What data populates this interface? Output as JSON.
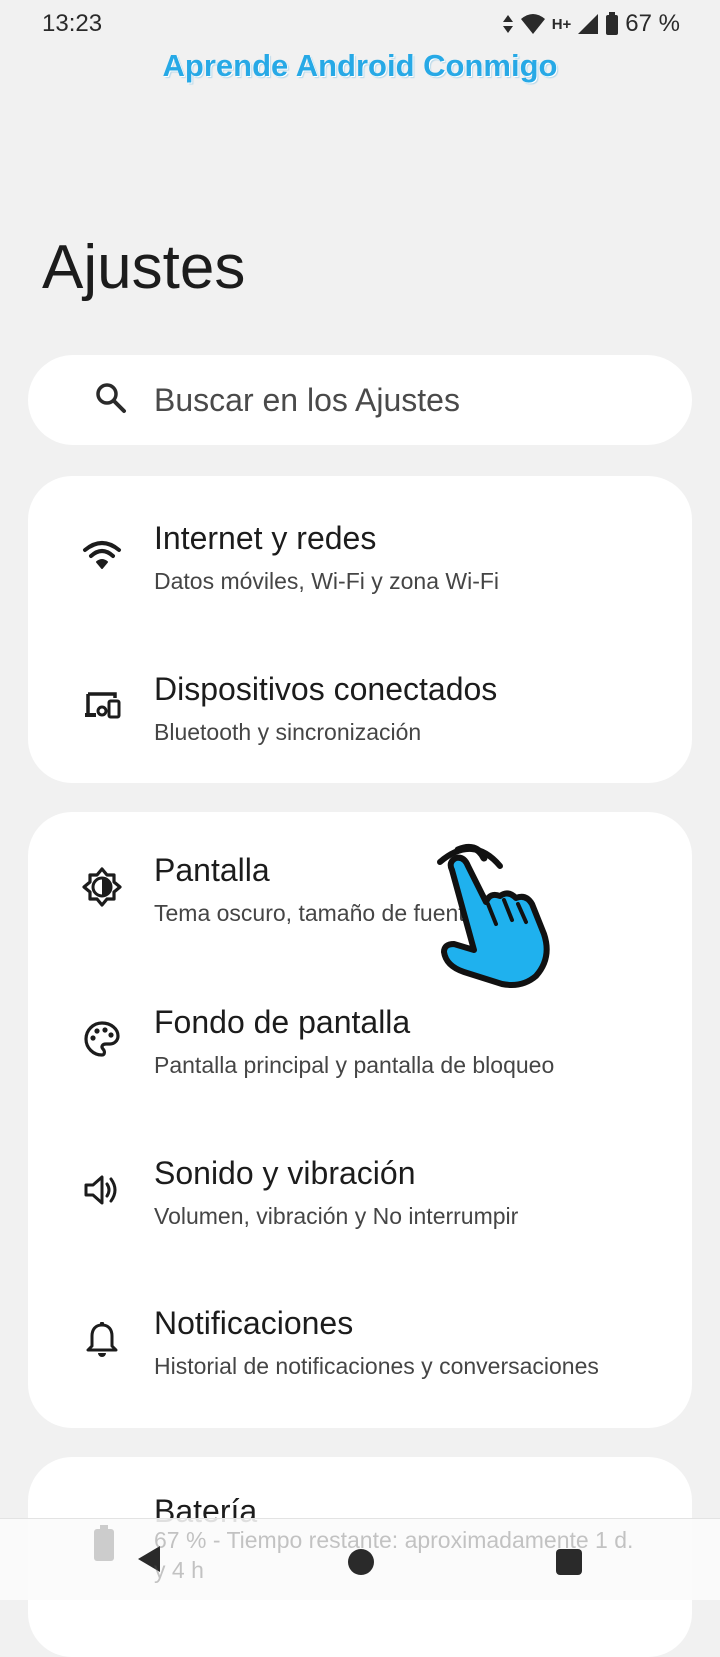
{
  "status": {
    "time": "13:23",
    "network": "H+",
    "battery": "67 %"
  },
  "watermark": "Aprende Android Conmigo",
  "page_title": "Ajustes",
  "search": {
    "placeholder": "Buscar en los Ajustes",
    "icon": "search-icon"
  },
  "groups": [
    {
      "items": [
        {
          "title": "Internet y redes",
          "subtitle": "Datos móviles, Wi-Fi y zona Wi-Fi",
          "icon": "wifi-icon"
        },
        {
          "title": "Dispositivos conectados",
          "subtitle": "Bluetooth y sincronización",
          "icon": "devices-icon"
        }
      ]
    },
    {
      "items": [
        {
          "title": "Pantalla",
          "subtitle": "Tema oscuro, tamaño de fuente, brillo",
          "icon": "brightness-icon"
        },
        {
          "title": "Fondo de pantalla",
          "subtitle": "Pantalla principal y pantalla de bloqueo",
          "icon": "palette-icon"
        },
        {
          "title": "Sonido y vibración",
          "subtitle": "Volumen, vibración y No interrumpir",
          "icon": "speaker-icon"
        },
        {
          "title": "Notificaciones",
          "subtitle": "Historial de notificaciones y conversaciones",
          "icon": "bell-icon"
        }
      ]
    },
    {
      "items": [
        {
          "title": "Batería",
          "subtitle": "67 % - Tiempo restante: aproximadamente 1 d. y 4 h",
          "icon": "battery-icon"
        }
      ]
    }
  ],
  "colors": {
    "background": "#f1f1f1",
    "card": "#ffffff",
    "watermark": "#27a9e6",
    "hand": "#1fb1ee"
  }
}
